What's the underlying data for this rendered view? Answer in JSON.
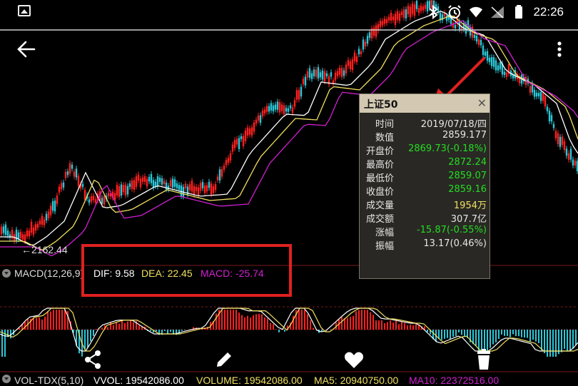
{
  "status_bar": {
    "time": "22:26",
    "icons": [
      "image-icon",
      "bluetooth-icon",
      "alarm-icon",
      "wifi-icon",
      "sim-icon",
      "battery-icon"
    ]
  },
  "chart": {
    "low_price_label": "←2162.44",
    "colors": {
      "up": "#ff2020",
      "down": "#2cc6d6",
      "ma1": "#ffffff",
      "ma2": "#f0e060",
      "ma3": "#d020d0"
    }
  },
  "macd": {
    "indicator_label": "MACD(12,26,9)",
    "dif": "DIF: 9.58",
    "dea": "DEA: 22.45",
    "macd": "MACD: -25.74",
    "colors": {
      "dif": "#ffffff",
      "dea": "#f0e060",
      "macd": "#d020d0"
    }
  },
  "tooltip": {
    "title": "上证50",
    "close_icon": "close-icon",
    "rows": [
      {
        "label": "时间",
        "value": "2019/07/18/四",
        "color": "#e6e6e6"
      },
      {
        "label": "数值",
        "value": "2859.177",
        "color": "#e6e6e6"
      },
      {
        "label": "开盘价",
        "value": "2869.73(-0.18%)",
        "color": "#22dd22"
      },
      {
        "label": "最高价",
        "value": "2872.24",
        "color": "#22dd22"
      },
      {
        "label": "最低价",
        "value": "2859.07",
        "color": "#22dd22"
      },
      {
        "label": "收盘价",
        "value": "2859.16",
        "color": "#22dd22"
      },
      {
        "label": "成交量",
        "value": "1954万",
        "color": "#f0e060"
      },
      {
        "label": "成交额",
        "value": "307.7亿",
        "color": "#e6e6e6"
      },
      {
        "label": "涨幅",
        "value": "-15.87(-0.55%)",
        "color": "#22dd22"
      },
      {
        "label": "振幅",
        "value": "13.17(0.46%)",
        "color": "#e6e6e6"
      }
    ]
  },
  "toolbar": {
    "buttons": [
      "share-icon",
      "edit-icon",
      "heart-icon",
      "delete-icon"
    ]
  },
  "volume": {
    "indicator_label": "VOL-TDX(5,10)",
    "vvol": "VVOL: 19542086.00",
    "volume": "VOLUME: 19542086.00",
    "ma5": "MA5: 20940750.00",
    "ma10": "MA10: 22372516.00",
    "colors": {
      "vvol": "#ffffff",
      "volume": "#f0e060",
      "ma5": "#f0e060",
      "ma10": "#d020d0"
    }
  }
}
